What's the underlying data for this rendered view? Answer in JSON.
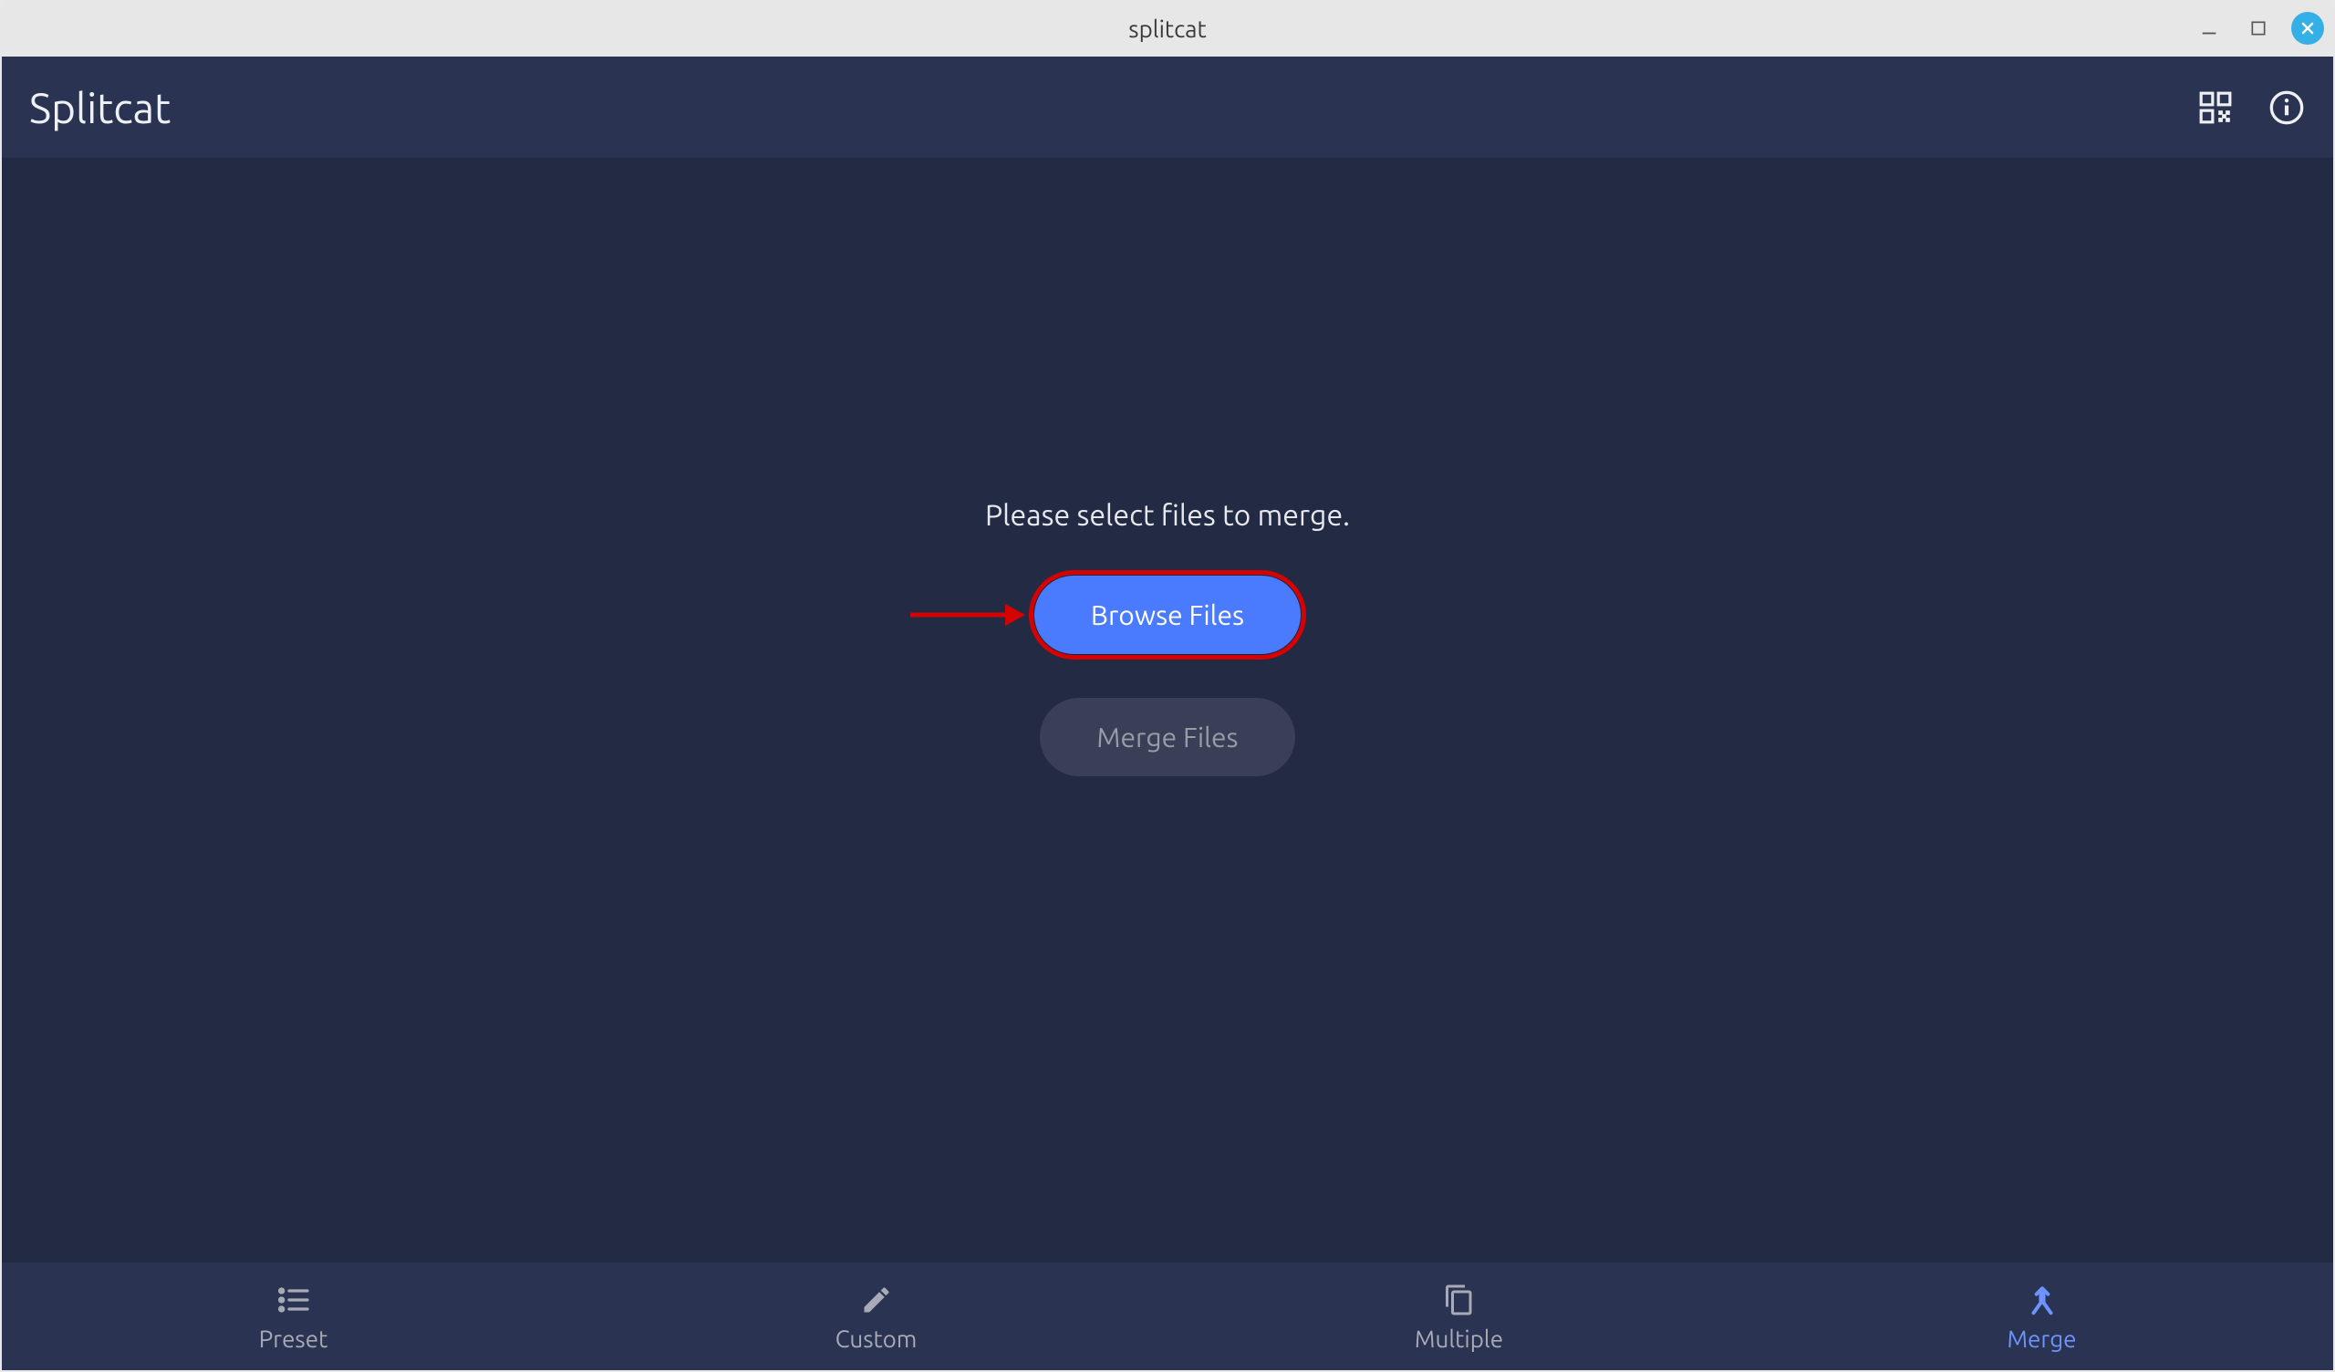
{
  "window": {
    "title": "splitcat"
  },
  "header": {
    "app_name": "Splitcat"
  },
  "main": {
    "instruction": "Please select files to merge.",
    "browse_button": "Browse Files",
    "merge_button": "Merge Files"
  },
  "nav": {
    "items": [
      {
        "label": "Preset",
        "icon": "list-icon",
        "active": false
      },
      {
        "label": "Custom",
        "icon": "pencil-icon",
        "active": false
      },
      {
        "label": "Multiple",
        "icon": "copy-icon",
        "active": false
      },
      {
        "label": "Merge",
        "icon": "merge-icon",
        "active": true
      }
    ]
  },
  "annotation": {
    "target": "browse-files-button",
    "arrow_color": "#d50202"
  }
}
